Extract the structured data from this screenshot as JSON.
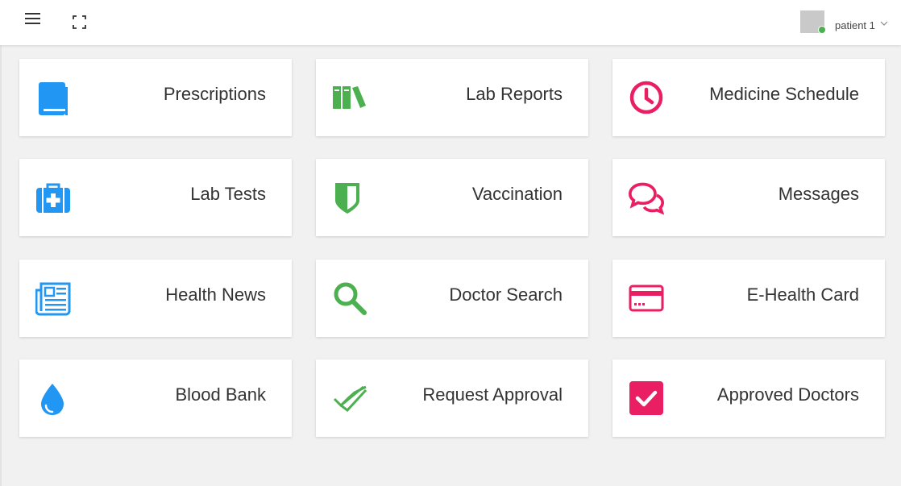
{
  "header": {
    "menu_icon": "hamburger-icon",
    "fullscreen_icon": "fullscreen-icon",
    "user": {
      "name": "patient 1",
      "status_color": "#4caf50"
    }
  },
  "colors": {
    "blue": "#2196f3",
    "green": "#4caf50",
    "pink": "#e91e63"
  },
  "tiles": [
    {
      "label": "Prescriptions",
      "icon": "book-icon",
      "color": "#2196f3"
    },
    {
      "label": "Lab Reports",
      "icon": "books-icon",
      "color": "#4caf50"
    },
    {
      "label": "Medicine Schedule",
      "icon": "clock-icon",
      "color": "#e91e63"
    },
    {
      "label": "Lab Tests",
      "icon": "medical-kit-icon",
      "color": "#2196f3"
    },
    {
      "label": "Vaccination",
      "icon": "shield-icon",
      "color": "#4caf50"
    },
    {
      "label": "Messages",
      "icon": "chat-bubbles-icon",
      "color": "#e91e63"
    },
    {
      "label": "Health News",
      "icon": "newspaper-icon",
      "color": "#2196f3"
    },
    {
      "label": "Doctor Search",
      "icon": "search-icon",
      "color": "#4caf50"
    },
    {
      "label": "E-Health Card",
      "icon": "credit-card-icon",
      "color": "#e91e63"
    },
    {
      "label": "Blood Bank",
      "icon": "drop-icon",
      "color": "#2196f3"
    },
    {
      "label": "Request Approval",
      "icon": "double-check-icon",
      "color": "#4caf50"
    },
    {
      "label": "Approved Doctors",
      "icon": "checkbox-icon",
      "color": "#e91e63"
    }
  ]
}
